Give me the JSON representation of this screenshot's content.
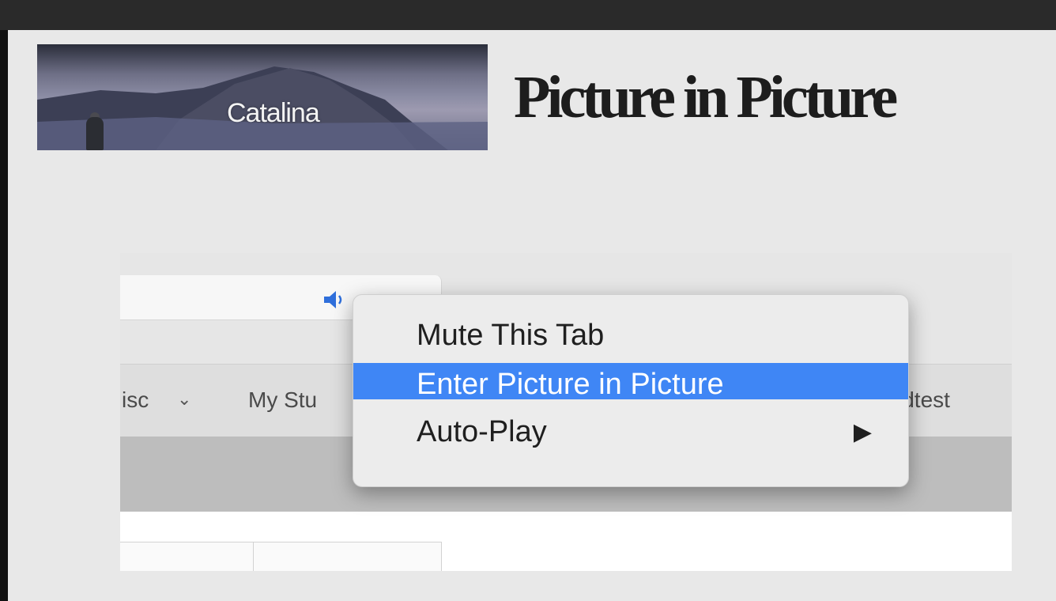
{
  "slide": {
    "title": "Picture in Picture",
    "banner_text": "Catalina"
  },
  "browser": {
    "bookmarks": [
      "isc",
      "My Stu",
      "ldtest"
    ],
    "speaker_icon": "speaker-icon"
  },
  "context_menu": {
    "items": [
      {
        "label": "Mute This Tab",
        "highlighted": false
      },
      {
        "label": "Enter Picture in Picture",
        "highlighted": true
      },
      {
        "label": "Auto-Play",
        "submenu_icon": "submenu-arrow-icon"
      }
    ],
    "highlight_color": "#3f86f5"
  }
}
